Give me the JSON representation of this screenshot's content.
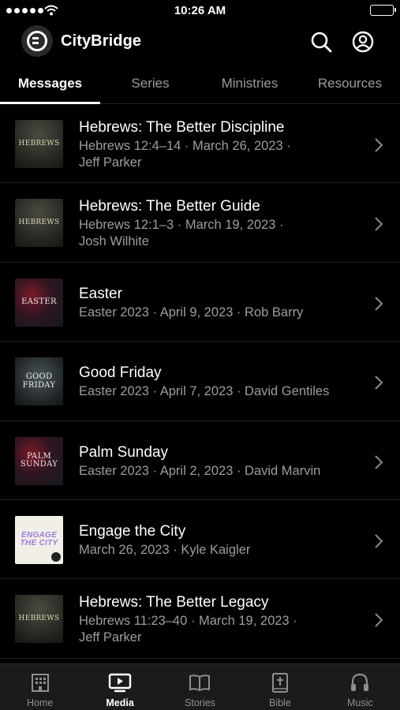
{
  "status_bar": {
    "time": "10:26 AM"
  },
  "header": {
    "app_name": "CityBridge"
  },
  "tabs": [
    {
      "label": "Messages",
      "active": true
    },
    {
      "label": "Series",
      "active": false
    },
    {
      "label": "Ministries",
      "active": false
    },
    {
      "label": "Resources",
      "active": false
    }
  ],
  "messages": [
    {
      "title": "Hebrews: The Better Discipline",
      "meta_line1": "Hebrews 12:4–14 · March 26, 2023 ·",
      "meta_line2": "Jeff Parker",
      "thumb_text": "HEBREWS"
    },
    {
      "title": "Hebrews: The Better Guide",
      "meta_line1": "Hebrews 12:1–3 · March 19, 2023 ·",
      "meta_line2": "Josh Wilhite",
      "thumb_text": "HEBREWS"
    },
    {
      "title": "Easter",
      "meta_line1": "Easter 2023 · April 9, 2023 · Rob Barry",
      "thumb_text": "EASTER"
    },
    {
      "title": "Good Friday",
      "meta_line1": "Easter 2023 · April 7, 2023 · David Gentiles",
      "thumb_text": "GOOD FRIDAY"
    },
    {
      "title": "Palm Sunday",
      "meta_line1": "Easter 2023 · April 2, 2023 · David Marvin",
      "thumb_text": "PALM SUNDAY"
    },
    {
      "title": "Engage the City",
      "meta_line1": "March 26, 2023 · Kyle Kaigler",
      "thumb_text": "ENGAGE THE CITY"
    },
    {
      "title": "Hebrews: The Better Legacy",
      "meta_line1": "Hebrews 11:23–40 · March 19, 2023 ·",
      "meta_line2": "Jeff Parker",
      "thumb_text": "HEBREWS"
    }
  ],
  "tabbar": [
    {
      "label": "Home",
      "icon": "building-icon",
      "active": false
    },
    {
      "label": "Media",
      "icon": "play-screen-icon",
      "active": true
    },
    {
      "label": "Stories",
      "icon": "open-book-icon",
      "active": false
    },
    {
      "label": "Bible",
      "icon": "bible-cross-icon",
      "active": false
    },
    {
      "label": "Music",
      "icon": "headphones-icon",
      "active": false
    }
  ],
  "colors": {
    "background": "#000000",
    "tabbar_bg": "#1b1b1b",
    "secondary_text": "#9d9d9d"
  }
}
